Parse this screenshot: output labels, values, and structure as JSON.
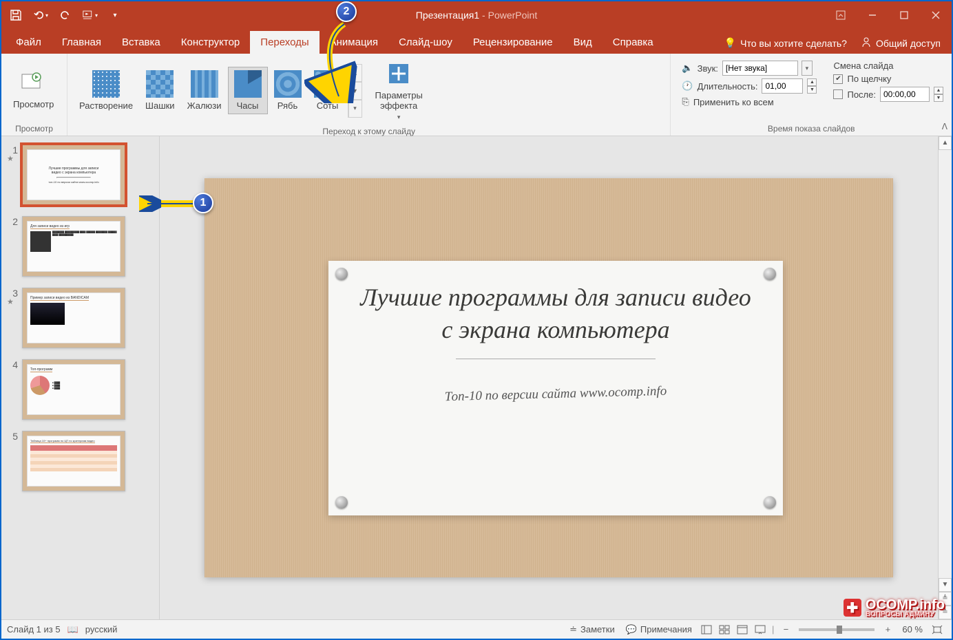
{
  "title": {
    "doc": "Презентация1",
    "app": "PowerPoint"
  },
  "tabs": [
    "Файл",
    "Главная",
    "Вставка",
    "Конструктор",
    "Переходы",
    "Анимация",
    "Слайд-шоу",
    "Рецензирование",
    "Вид",
    "Справка"
  ],
  "active_tab": "Переходы",
  "tell_me": "Что вы хотите сделать?",
  "share": "Общий доступ",
  "ribbon": {
    "preview_btn": "Просмотр",
    "preview_group": "Просмотр",
    "transitions": [
      "Растворение",
      "Шашки",
      "Жалюзи",
      "Часы",
      "Рябь",
      "Соты"
    ],
    "selected_transition": "Часы",
    "transition_group": "Переход к этому слайду",
    "effect_options": "Параметры\nэффекта",
    "sound_label": "Звук:",
    "sound_value": "[Нет звука]",
    "duration_label": "Длительность:",
    "duration_value": "01,00",
    "apply_all": "Применить ко всем",
    "advance_header": "Смена слайда",
    "on_click": "По щелчку",
    "after_label": "После:",
    "after_value": "00:00,00",
    "timing_group": "Время показа слайдов"
  },
  "thumbs": {
    "slides": [
      1,
      2,
      3,
      4,
      5
    ],
    "stars": [
      1,
      3
    ],
    "selected": 1,
    "t1a": "Лучшие программы для записи",
    "t1b": "видео с экрана компьютера",
    "t2": "Для записи видео из игр",
    "t3": "Пример записи видео из BANDICAM",
    "t4": "Топ-программ",
    "t5": "Таблица 10+ программ по ЦП по критериям видео"
  },
  "slide": {
    "title": "Лучшие программы для записи видео с экрана компьютера",
    "subtitle": "Топ-10 по версии сайта www.ocomp.info"
  },
  "status": {
    "slide_info": "Слайд 1 из 5",
    "language": "русский",
    "notes": "Заметки",
    "comments": "Примечания",
    "zoom": "60 %"
  },
  "watermark": {
    "main": "OCOMP.info",
    "sub": "ВОПРОСЫ АДМИНУ"
  },
  "annotations": {
    "b1": "1",
    "b2": "2"
  }
}
